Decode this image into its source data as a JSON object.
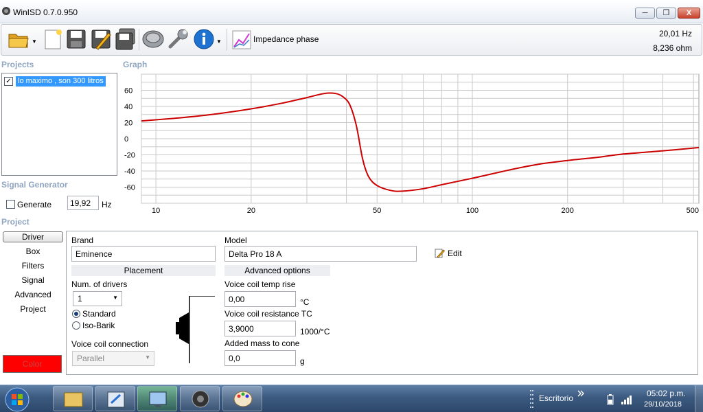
{
  "window": {
    "title": "WinISD 0.7.0.950",
    "min_glyph": "─",
    "max_glyph": "❐",
    "close_glyph": "X"
  },
  "toolbar": {
    "graph_type": "Impedance phase",
    "readout_hz": "20,01 Hz",
    "readout_ohm": "8,236 ohm",
    "dropdown_glyph": "▼"
  },
  "projects": {
    "title": "Projects",
    "items": [
      {
        "label": "lo maximo , son  300 litros",
        "checked_glyph": "✓"
      }
    ]
  },
  "graph": {
    "title": "Graph"
  },
  "signal_generator": {
    "title": "Signal Generator",
    "generate_label": "Generate",
    "frequency": "19,92",
    "unit": "Hz"
  },
  "project": {
    "title": "Project",
    "nav": [
      "Driver",
      "Box",
      "Filters",
      "Signal",
      "Advanced",
      "Project"
    ],
    "color_label": "Color"
  },
  "driver": {
    "brand_label": "Brand",
    "brand": "Eminence",
    "model_label": "Model",
    "model": "Delta Pro 18 A",
    "edit_label": "Edit",
    "placement_head": "Placement",
    "num_drivers_label": "Num. of drivers",
    "num_drivers": "1",
    "standard_label": "Standard",
    "isobarik_label": "Iso-Barik",
    "vc_connection_label": "Voice coil connection",
    "vc_connection": "Parallel",
    "advanced_head": "Advanced options",
    "vc_temp_rise_label": "Voice coil temp rise",
    "vc_temp_rise": "0,00",
    "vc_temp_rise_unit": "°C",
    "vc_res_tc_label": "Voice coil resistance TC",
    "vc_res_tc": "3,9000",
    "vc_res_tc_unit": "1000/°C",
    "added_mass_label": "Added mass to cone",
    "added_mass": "0,0",
    "added_mass_unit": "g"
  },
  "chart_data": {
    "type": "line",
    "x_scale": "log",
    "xlim": [
      9,
      520
    ],
    "ylim": [
      -80,
      80
    ],
    "x_ticks": [
      10,
      20,
      50,
      100,
      200,
      500
    ],
    "x_tick_labels": [
      "10",
      "20",
      "50",
      "100",
      "200",
      "500"
    ],
    "y_ticks": [
      60,
      40,
      20,
      0,
      -20,
      -40,
      -60
    ],
    "y_tick_labels": [
      "60",
      "40",
      "20",
      "0",
      "-20",
      "-40",
      "-60"
    ],
    "grid": true,
    "series": [
      {
        "color": "#cc0000",
        "x": [
          9,
          12,
          15,
          20,
          25,
          30,
          34,
          37,
          39,
          41,
          43,
          45,
          47,
          50,
          55,
          60,
          70,
          80,
          100,
          130,
          160,
          200,
          250,
          300,
          400,
          520
        ],
        "y": [
          22,
          26,
          30,
          37,
          44,
          51,
          56,
          56,
          52,
          42,
          16,
          -25,
          -47,
          -58,
          -64,
          -65,
          -62,
          -57,
          -49,
          -39,
          -32,
          -27,
          -23,
          -19,
          -15,
          -11
        ]
      }
    ]
  },
  "taskbar": {
    "tray_label": "Escritorio",
    "time": "05:02 p.m.",
    "date": "29/10/2018"
  }
}
